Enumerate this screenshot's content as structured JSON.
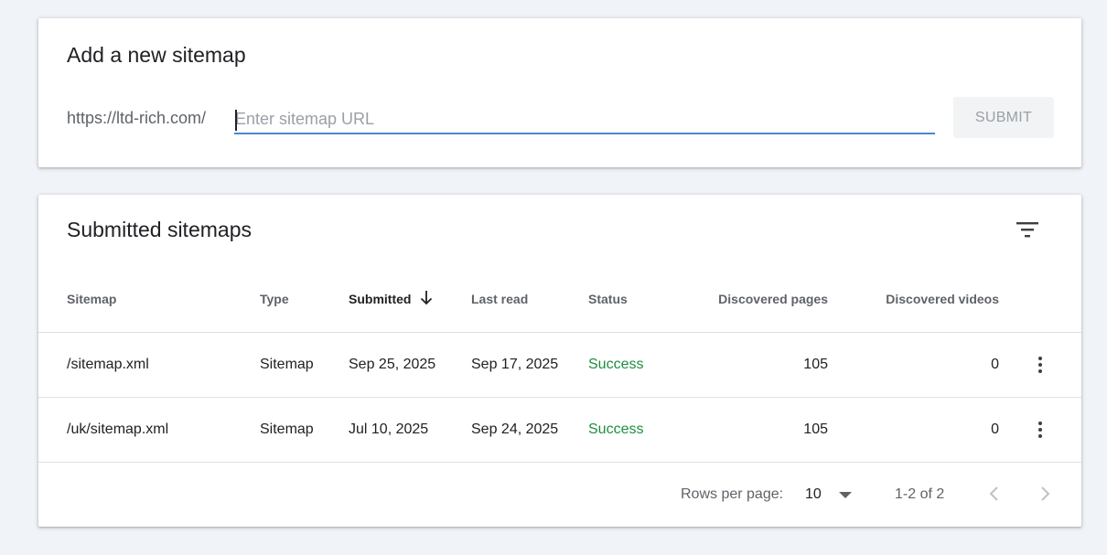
{
  "add_sitemap": {
    "title": "Add a new sitemap",
    "url_prefix": "https://ltd-rich.com/",
    "input_value": "",
    "input_placeholder": "Enter sitemap URL",
    "submit_label": "SUBMIT"
  },
  "submitted": {
    "title": "Submitted sitemaps",
    "columns": {
      "sitemap": "Sitemap",
      "type": "Type",
      "submitted": "Submitted",
      "last_read": "Last read",
      "status": "Status",
      "discovered_pages": "Discovered pages",
      "discovered_videos": "Discovered videos"
    },
    "sorted_column": "submitted",
    "sort_direction": "descending",
    "rows": [
      {
        "sitemap": "/sitemap.xml",
        "type": "Sitemap",
        "submitted": "Sep 25, 2025",
        "last_read": "Sep 17, 2025",
        "status": "Success",
        "discovered_pages": "105",
        "discovered_videos": "0"
      },
      {
        "sitemap": "/uk/sitemap.xml",
        "type": "Sitemap",
        "submitted": "Jul 10, 2025",
        "last_read": "Sep 24, 2025",
        "status": "Success",
        "discovered_pages": "105",
        "discovered_videos": "0"
      }
    ],
    "pagination": {
      "rows_per_page_label": "Rows per page:",
      "rows_per_page_value": "10",
      "range_label": "1-2 of 2"
    }
  },
  "icons": {
    "filter": "filter-icon",
    "sort": "arrow-down-icon",
    "more": "more-vert-icon",
    "prev": "chevron-left-icon",
    "next": "chevron-right-icon",
    "dropdown": "caret-down-icon"
  },
  "colors": {
    "accent": "#4a86d8",
    "success": "#1e8e3e",
    "background": "#f0f3f8"
  }
}
